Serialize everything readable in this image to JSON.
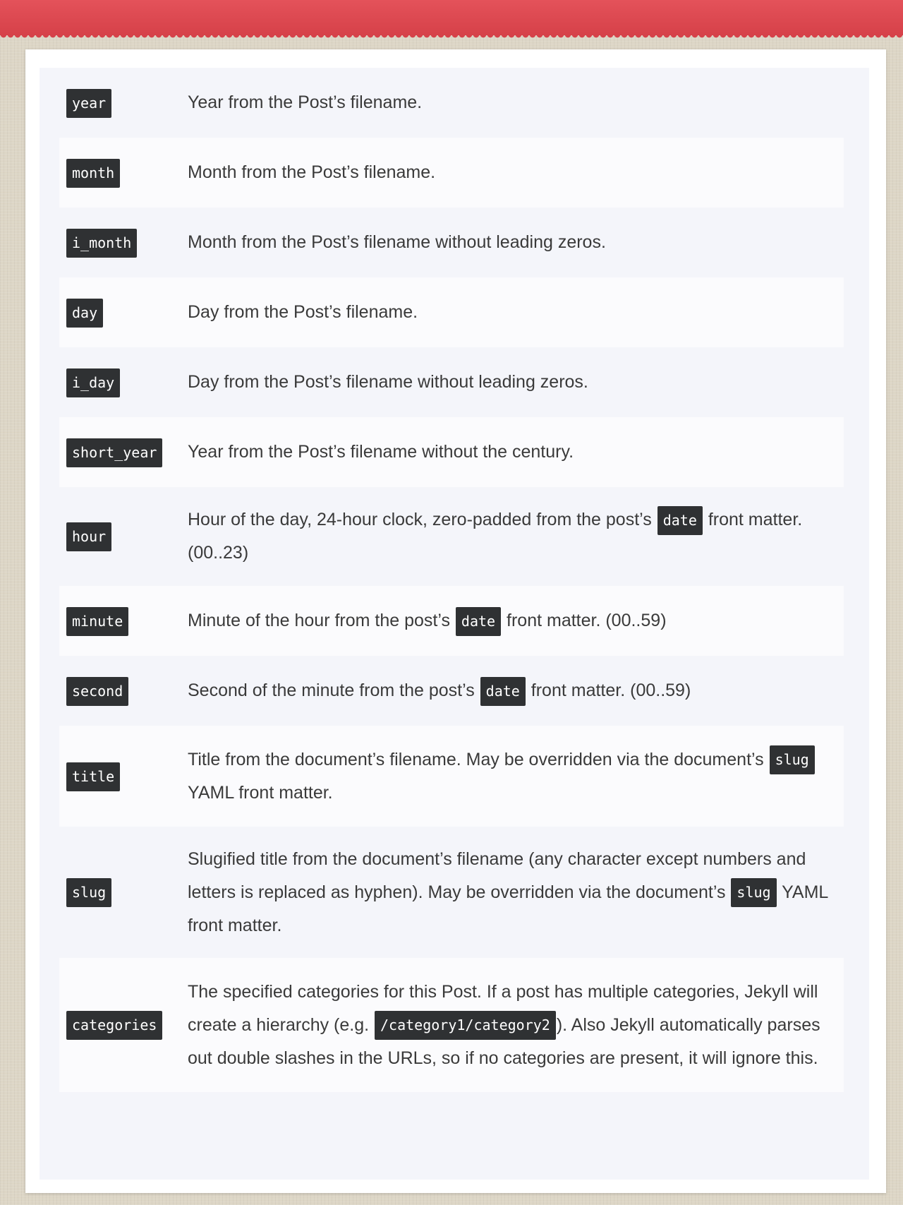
{
  "rows": [
    {
      "key": "year",
      "desc": [
        "Year from the Post’s filename."
      ]
    },
    {
      "key": "month",
      "desc": [
        "Month from the Post’s filename."
      ]
    },
    {
      "key": "i_month",
      "desc": [
        "Month from the Post’s filename without leading zeros."
      ]
    },
    {
      "key": "day",
      "desc": [
        "Day from the Post’s filename."
      ]
    },
    {
      "key": "i_day",
      "desc": [
        "Day from the Post’s filename without leading zeros."
      ]
    },
    {
      "key": "short_year",
      "desc": [
        "Year from the Post’s filename without the century."
      ]
    },
    {
      "key": "hour",
      "desc": [
        "Hour of the day, 24-hour clock, zero-padded from the post’s ",
        {
          "code": "date"
        },
        " front matter. (00..23)"
      ]
    },
    {
      "key": "minute",
      "desc": [
        "Minute of the hour from the post’s ",
        {
          "code": "date"
        },
        " front matter. (00..59)"
      ]
    },
    {
      "key": "second",
      "desc": [
        "Second of the minute from the post’s ",
        {
          "code": "date"
        },
        " front matter. (00..59)"
      ]
    },
    {
      "key": "title",
      "desc": [
        "Title from the document’s filename. May be overridden via the document’s ",
        {
          "code": "slug"
        },
        " YAML front matter."
      ]
    },
    {
      "key": "slug",
      "desc": [
        "Slugified title from the document’s filename (any character except numbers and letters is replaced as hyphen). May be overridden via the document’s ",
        {
          "code": "slug"
        },
        " YAML front matter."
      ]
    },
    {
      "key": "categories",
      "desc": [
        "The specified categories for this Post. If a post has multiple categories, Jekyll will create a hierarchy (e.g. ",
        {
          "code": "/category1/category2"
        },
        "). Also Jekyll automatically parses out double slashes in the URLs, so if no categories are present, it will ignore this."
      ]
    }
  ],
  "colors": {
    "top_band": "#d64149",
    "code_bg": "#2f3133",
    "code_text": "#ffffff",
    "text": "#3a3a3a",
    "stripe_bg": "#fbfbfd",
    "table_bg": "#f4f5fa"
  }
}
